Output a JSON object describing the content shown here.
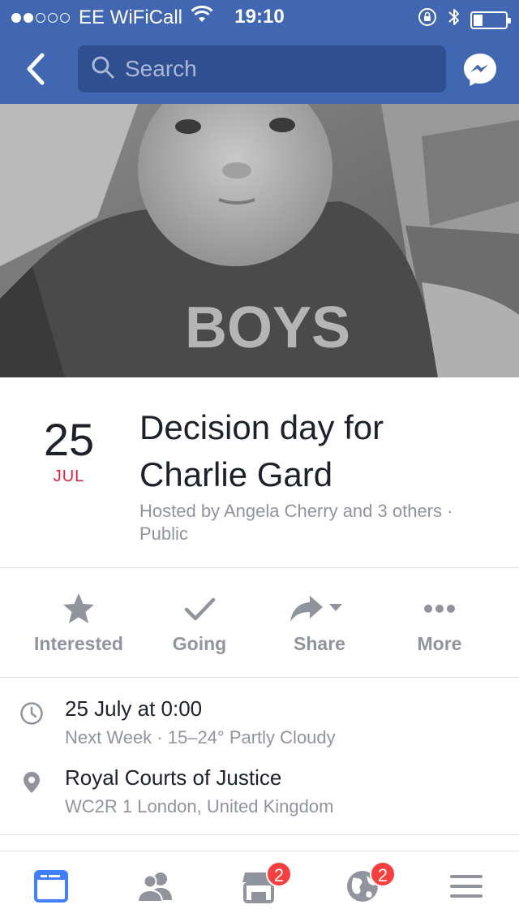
{
  "status_bar": {
    "carrier": "EE WiFiCall",
    "time": "19:10",
    "signal_bars_filled": 2,
    "signal_bars_total": 5,
    "battery_level": 0.3
  },
  "nav": {
    "search_placeholder": "Search",
    "back_icon": "chevron-left-icon",
    "messenger_icon": "messenger-icon"
  },
  "cover": {
    "shirt_text": "BOYS"
  },
  "event": {
    "day": "25",
    "month": "JUL",
    "title": "Decision day for Charlie Gard",
    "hosted": "Hosted by Angela Cherry and 3 others · Public"
  },
  "actions": [
    {
      "label": "Interested",
      "icon": "star-icon"
    },
    {
      "label": "Going",
      "icon": "check-icon"
    },
    {
      "label": "Share",
      "icon": "share-icon"
    },
    {
      "label": "More",
      "icon": "more-icon"
    }
  ],
  "details": {
    "time": {
      "primary": "25 July at 0:00",
      "secondary": "Next Week · 15–24° Partly Cloudy",
      "icon": "clock-icon"
    },
    "location": {
      "primary": "Royal Courts of Justice",
      "secondary": "WC2R 1 London, United Kingdom",
      "icon": "location-pin-icon"
    }
  },
  "tabs": [
    {
      "name": "news-feed",
      "icon": "news-feed-icon",
      "badge": ""
    },
    {
      "name": "friends",
      "icon": "friends-icon",
      "badge": ""
    },
    {
      "name": "marketplace",
      "icon": "marketplace-icon",
      "badge": "2"
    },
    {
      "name": "notifications",
      "icon": "globe-icon",
      "badge": "2"
    },
    {
      "name": "menu",
      "icon": "menu-icon",
      "badge": ""
    }
  ],
  "colors": {
    "brand_blue": "#4267b2",
    "date_red": "#e41e3f",
    "badge_red": "#fa3e3e",
    "active_tab": "#4080ff",
    "inactive_icon": "#90949c"
  }
}
